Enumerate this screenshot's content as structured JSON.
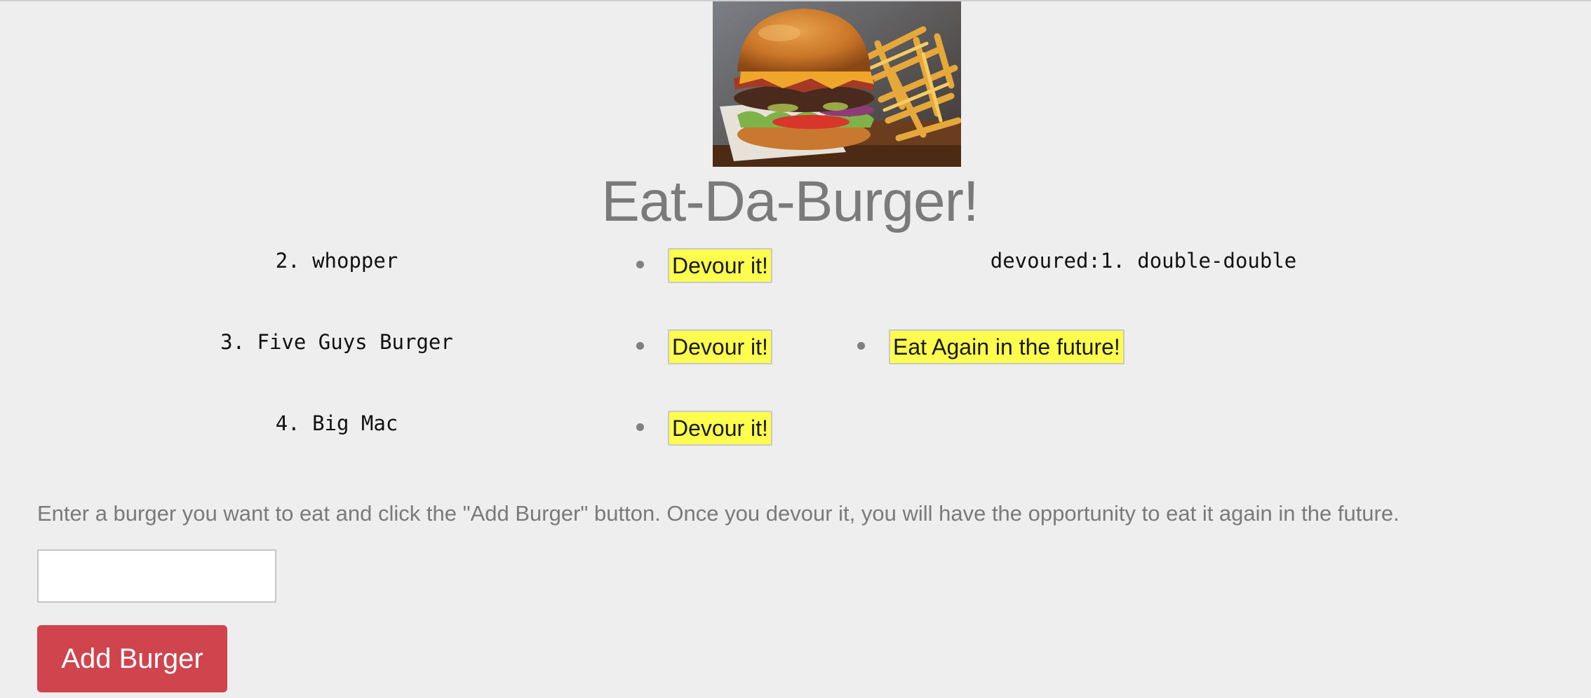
{
  "header": {
    "image_alt": "burger and fries",
    "title": "Eat-Da-Burger!"
  },
  "undevoured": [
    {
      "label": "2. whopper",
      "button_label": "Devour it!"
    },
    {
      "label": "3. Five Guys Burger",
      "button_label": "Devour it!"
    },
    {
      "label": "4. Big Mac",
      "button_label": "Devour it!"
    }
  ],
  "devoured": {
    "label": "devoured:1. double-double",
    "button_label": "Eat Again in the future!"
  },
  "form": {
    "instructions": "Enter a burger you want to eat and click the \"Add Burger\" button. Once you devour it, you will have the opportunity to eat it again in the future.",
    "input_value": "",
    "input_placeholder": "",
    "submit_label": "Add Burger"
  },
  "colors": {
    "background": "#eeeeee",
    "button_yellow": "#fdfd4f",
    "add_button": "#d0444e",
    "title_gray": "#7a7a7a"
  }
}
